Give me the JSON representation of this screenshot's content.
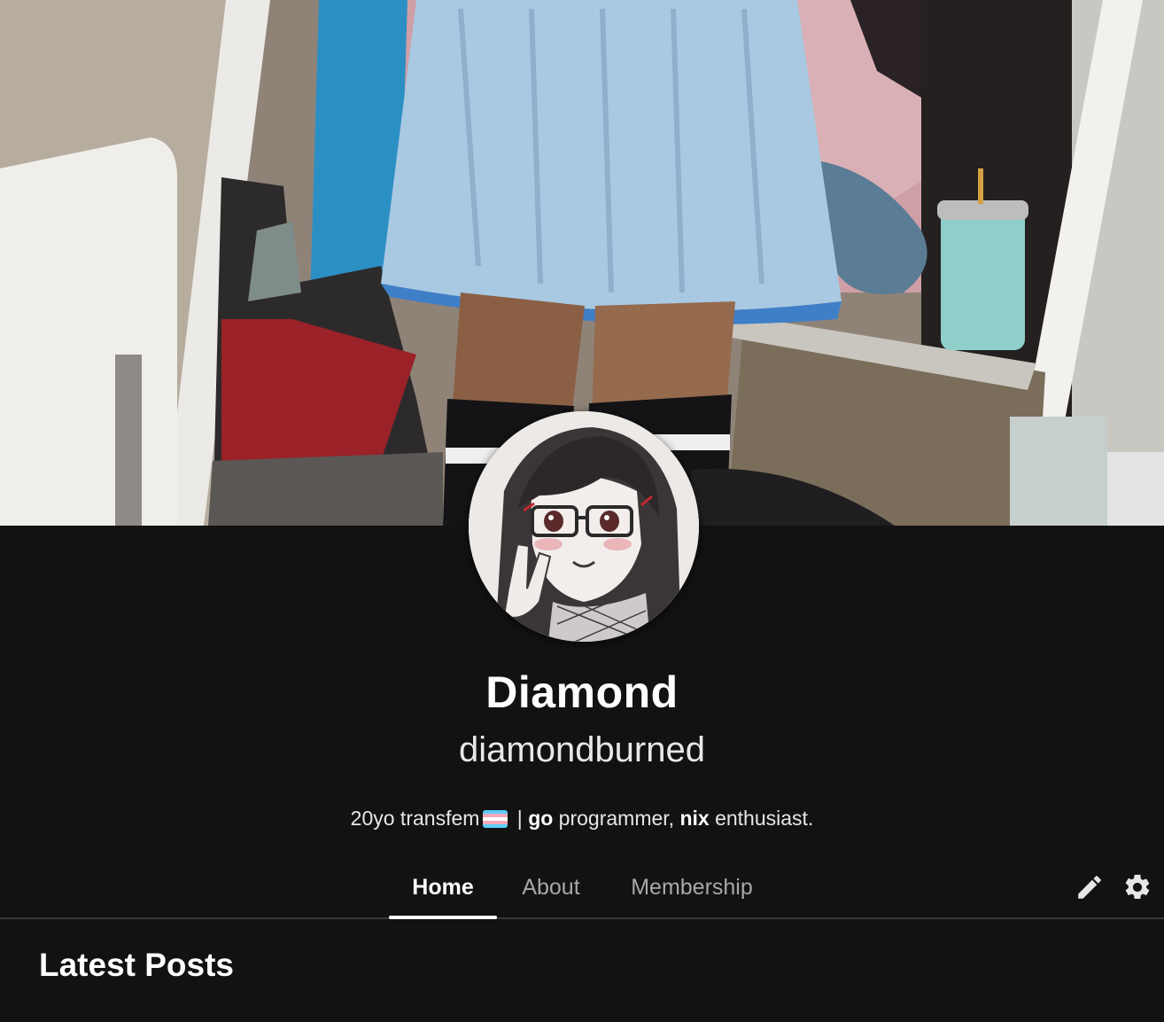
{
  "profile": {
    "display_name": "Diamond",
    "handle": "diamondburned",
    "bio": {
      "prefix": "20yo transfem",
      "separator": " | ",
      "lang1": "go",
      "middle": " programmer, ",
      "lang2": "nix",
      "suffix": " enthusiast."
    }
  },
  "images": {
    "cover": "cover-photo",
    "avatar": "avatar-drawing"
  },
  "flag_colors": [
    "#5BCEFA",
    "#F5A9B8",
    "#FFFFFF",
    "#F5A9B8",
    "#5BCEFA"
  ],
  "tabs": [
    {
      "label": "Home",
      "active": true
    },
    {
      "label": "About",
      "active": false
    },
    {
      "label": "Membership",
      "active": false
    }
  ],
  "actions": {
    "edit_icon": "pencil-icon",
    "settings_icon": "gear-icon"
  },
  "sections": {
    "latest_posts_title": "Latest Posts"
  },
  "colors": {
    "background": "#121212",
    "text": "#ffffff",
    "muted_text": "#a8a8a8",
    "divider": "#3a3a3a"
  }
}
